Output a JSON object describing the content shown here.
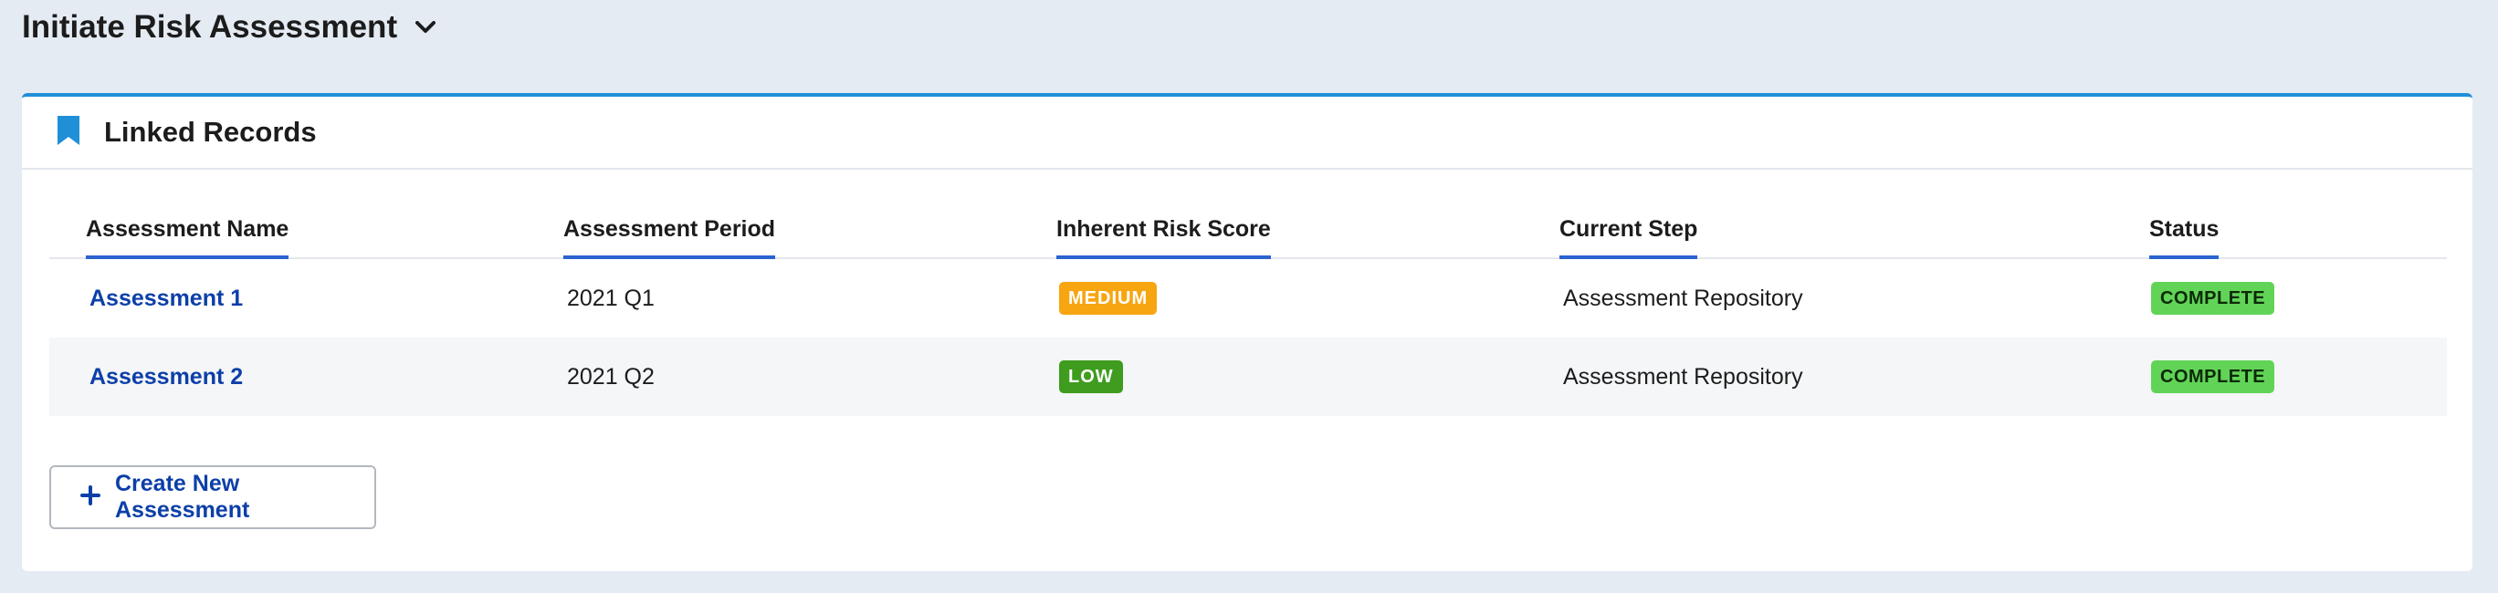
{
  "header": {
    "title": "Initiate Risk Assessment",
    "toggle_icon": "chevron-down-icon"
  },
  "card": {
    "title": "Linked Records",
    "icon": "bookmark-icon",
    "accent": "#1f8fd8"
  },
  "table": {
    "columns": [
      "Assessment Name",
      "Assessment Period",
      "Inherent Risk Score",
      "Current Step",
      "Status"
    ],
    "rows": [
      {
        "name": "Assessment 1",
        "period": "2021 Q1",
        "risk": "MEDIUM",
        "step": "Assessment Repository",
        "status": "COMPLETE"
      },
      {
        "name": "Assessment 2",
        "period": "2021 Q2",
        "risk": "LOW",
        "step": "Assessment Repository",
        "status": "COMPLETE"
      }
    ]
  },
  "actions": {
    "create_label": "Create New Assessment",
    "create_icon": "plus-icon"
  },
  "colors": {
    "link": "#0c3fa8",
    "header_underline": "#2b63d0",
    "medium_badge": "#f7a511",
    "low_badge": "#3f9c1e",
    "complete_badge": "#61d457"
  }
}
